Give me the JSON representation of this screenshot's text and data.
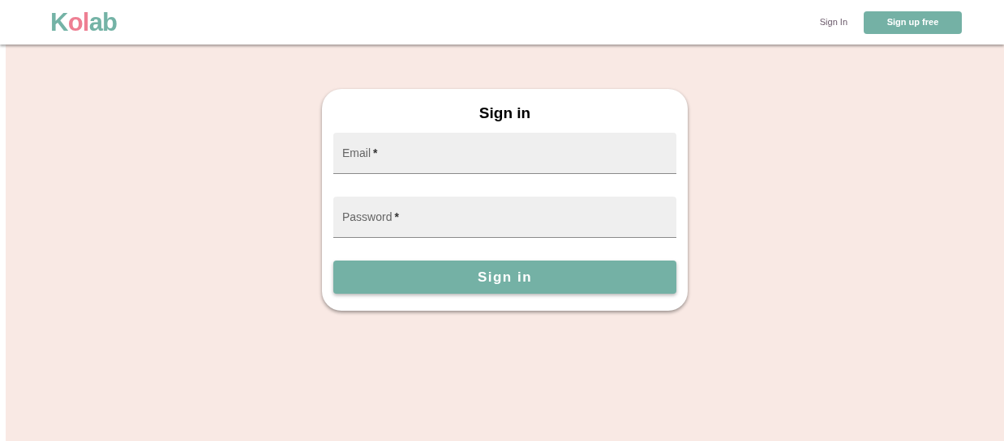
{
  "header": {
    "logo": [
      {
        "text": "K",
        "color": "#74b3a6"
      },
      {
        "text": "o",
        "color": "#ee7f93"
      },
      {
        "text": "l",
        "color": "#ee7f93"
      },
      {
        "text": "ab",
        "color": "#74b3a6"
      }
    ],
    "nav": [
      {
        "kind": "link",
        "label": "Sign In"
      },
      {
        "kind": "button",
        "label": "Sign up free"
      }
    ]
  },
  "form": {
    "title": "Sign in",
    "fields": [
      {
        "label": "Email",
        "required_mark": "*"
      },
      {
        "label": "Password",
        "required_mark": "*"
      }
    ],
    "submit": "Sign in"
  }
}
